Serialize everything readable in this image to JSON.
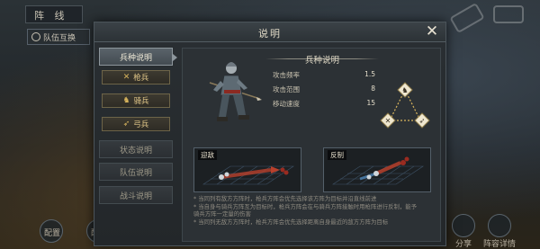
{
  "background": {
    "top_title": "阵 线",
    "team_button": "队伍互换",
    "bottom_left": [
      "配置",
      "配置"
    ],
    "bottom_right": [
      "分享",
      "阵容详情"
    ]
  },
  "modal": {
    "title": "说明",
    "close_label": "✕"
  },
  "sidebar": {
    "main_item": "兵种说明",
    "sub_items": [
      {
        "label": "枪兵",
        "icon": "spear-icon"
      },
      {
        "label": "骑兵",
        "icon": "horse-icon"
      },
      {
        "label": "弓兵",
        "icon": "bow-icon"
      }
    ],
    "other_items": [
      "状态说明",
      "队伍说明",
      "战斗说明"
    ]
  },
  "content": {
    "section_title": "兵种说明",
    "stats": [
      {
        "label": "攻击频率",
        "value": "1.5"
      },
      {
        "label": "攻击范围",
        "value": "8"
      },
      {
        "label": "移动速度",
        "value": "15"
      }
    ],
    "panel_left_label": "迎敌",
    "panel_right_label": "反制",
    "notes": [
      "* 当同列有敌方方阵时，枪兵方阵会优先选择该方阵为目标并沿直线前进",
      "* 当自身与骑兵方阵互为目标时，枪兵方阵会在与骑兵方阵接触时用枪阵进行反制，能予",
      "  骑兵方阵一定量的伤害",
      "* 当同列无敌方方阵时，枪兵方阵会优先选择距离自身最近的敌方方阵为目标"
    ]
  },
  "colors": {
    "accent_gold": "#d9b55d",
    "panel_red": "#b8402c",
    "panel_blue": "#4f86b8"
  }
}
